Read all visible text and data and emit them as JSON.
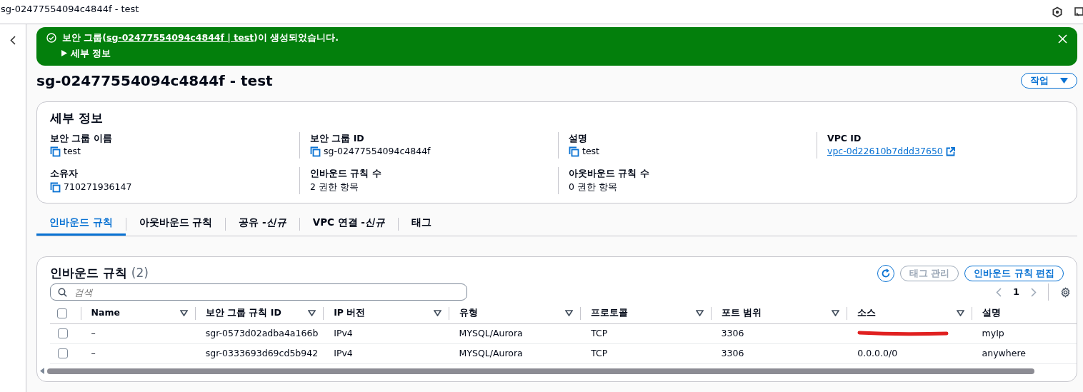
{
  "window": {
    "title": "sg-02477554094c4844f - test"
  },
  "flash": {
    "prefix": "보안 그룹(",
    "link": "sg-02477554094c4844f | test",
    "suffix": ")이 생성되었습니다.",
    "details_toggle": "세부 정보",
    "expanded": false
  },
  "header": {
    "title": "sg-02477554094c4844f - test",
    "actions_button": "작업"
  },
  "details": {
    "title": "세부 정보",
    "fields": [
      {
        "label": "보안 그룹 이름",
        "value": "test",
        "kind": "copy"
      },
      {
        "label": "보안 그룹 ID",
        "value": "sg-02477554094c4844f",
        "kind": "copy"
      },
      {
        "label": "설명",
        "value": "test",
        "kind": "copy"
      },
      {
        "label": "VPC ID",
        "value": "vpc-0d22610b7ddd37650",
        "kind": "link"
      },
      {
        "label": "소유자",
        "value": "710271936147",
        "kind": "copy"
      },
      {
        "label": "인바운드 규칙 수",
        "value": "2 권한 항목",
        "kind": "text"
      },
      {
        "label": "아웃바운드 규칙 수",
        "value": "0 권한 항목",
        "kind": "text"
      }
    ]
  },
  "tabs": [
    {
      "label": "인바운드 규칙",
      "selected": true
    },
    {
      "label": "아웃바운드 규칙",
      "selected": false
    },
    {
      "label": "공유 -*신규*",
      "selected": false
    },
    {
      "label": "VPC 연결 -*신규*",
      "selected": false
    },
    {
      "label": "태그",
      "selected": false
    }
  ],
  "rules_panel": {
    "title": "인바운드 규칙",
    "count": "(2)",
    "buttons": [
      {
        "label": "태그 관리",
        "disabled": true
      },
      {
        "label": "인바운드 규칙 편집",
        "disabled": false
      }
    ],
    "search": {
      "placeholder": "검색"
    },
    "pagination": {
      "page": "1"
    },
    "select_all_checked": false,
    "columns": [
      "Name",
      "보안 그룹 규칙 ID",
      "IP 버전",
      "유형",
      "프로토콜",
      "포트 범위",
      "소스",
      "설명"
    ],
    "rows": [
      {
        "selected": false,
        "name": "–",
        "rule_id": "sgr-0573d02adba4a166b",
        "ip_version": "IPv4",
        "type": "MYSQL/Aurora",
        "protocol": "TCP",
        "port_range": "3306",
        "source_redacted": true,
        "description": "myIp"
      },
      {
        "selected": false,
        "name": "–",
        "rule_id": "sgr-0333693d69cd5b942",
        "ip_version": "IPv4",
        "type": "MYSQL/Aurora",
        "protocol": "TCP",
        "port_range": "3306",
        "source": "0.0.0.0/0",
        "source_redacted": false,
        "description": "anywhere"
      }
    ]
  }
}
